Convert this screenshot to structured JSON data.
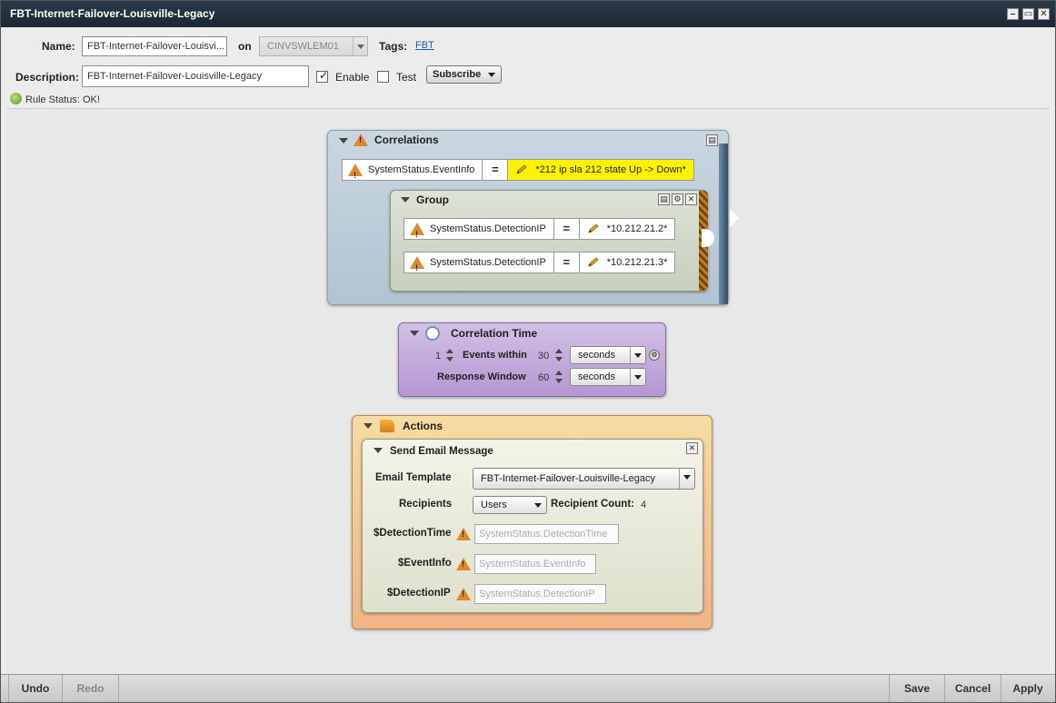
{
  "window": {
    "title": "FBT-Internet-Failover-Louisville-Legacy"
  },
  "header": {
    "name_label": "Name:",
    "name_value": "FBT-Internet-Failover-Louisvi...",
    "on_label": "on",
    "server_value": "CINVSWLEM01",
    "tags_label": "Tags:",
    "tag_link": "FBT",
    "description_label": "Description:",
    "description_value": "FBT-Internet-Failover-Louisville-Legacy",
    "enable_label": "Enable",
    "enable_checked": true,
    "test_label": "Test",
    "test_checked": false,
    "subscribe_label": "Subscribe",
    "status_text": "Rule Status: OK!"
  },
  "correlations": {
    "title": "Correlations",
    "condition": {
      "field": "SystemStatus.EventInfo",
      "operator": "=",
      "value": "*212 ip sla 212 state Up -> Down*"
    },
    "group": {
      "title": "Group",
      "conditions": [
        {
          "field": "SystemStatus.DetectionIP",
          "operator": "=",
          "value": "*10.212.21.2*"
        },
        {
          "field": "SystemStatus.DetectionIP",
          "operator": "=",
          "value": "*10.212.21.3*"
        }
      ]
    }
  },
  "correlation_time": {
    "title": "Correlation Time",
    "events_count": "1",
    "events_within_label": "Events within",
    "events_within_value": "30",
    "events_within_unit": "seconds",
    "response_window_label": "Response Window",
    "response_window_value": "60",
    "response_window_unit": "seconds"
  },
  "actions": {
    "title": "Actions",
    "send_email": {
      "title": "Send Email Message",
      "template_label": "Email Template",
      "template_value": "FBT-Internet-Failover-Louisville-Legacy",
      "recipients_label": "Recipients",
      "recipients_value": "Users",
      "recipient_count_label": "Recipient Count:",
      "recipient_count_value": "4",
      "vars": [
        {
          "label": "$DetectionTime",
          "value": "SystemStatus.DetectionTime"
        },
        {
          "label": "$EventInfo",
          "value": "SystemStatus.EventInfo"
        },
        {
          "label": "$DetectionIP",
          "value": "SystemStatus.DetectionIP"
        }
      ]
    }
  },
  "footer": {
    "undo": "Undo",
    "redo": "Redo",
    "save": "Save",
    "cancel": "Cancel",
    "apply": "Apply"
  },
  "colors": {
    "correlations_bg": "#bfcfdb",
    "group_bg": "#d3d9cc",
    "correlation_time_bg": "#c0a8d8",
    "actions_bg": "#f2c88a",
    "highlight": "#fff200"
  }
}
